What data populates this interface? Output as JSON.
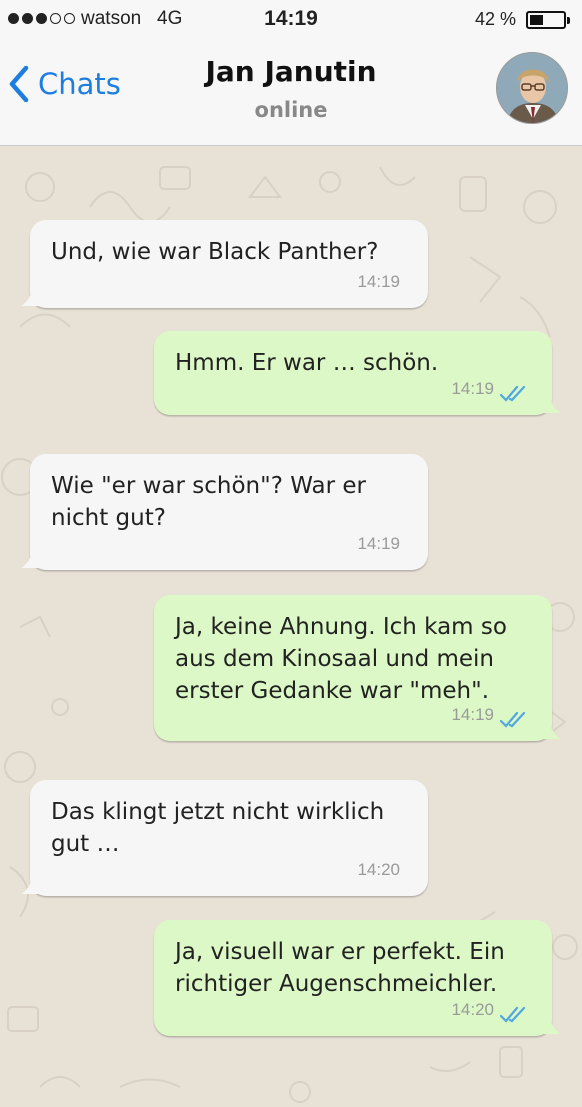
{
  "status_bar": {
    "carrier": "watson",
    "network": "4G",
    "time": "14:19",
    "battery_percent_label": "42 %",
    "battery_level": 0.42,
    "signal_bars_filled": 3,
    "signal_bars_total": 5
  },
  "header": {
    "back_label": "Chats",
    "contact_name": "Jan Janutin",
    "contact_status": "online"
  },
  "colors": {
    "accent": "#1e7ee0",
    "incoming_bubble": "#f6f6f6",
    "outgoing_bubble": "#dcf8c6",
    "read_ticks": "#4fa8e0",
    "chat_background": "#e8e1d6"
  },
  "messages": [
    {
      "direction": "incoming",
      "text": "Und, wie war Black Panther?",
      "time": "14:19"
    },
    {
      "direction": "outgoing",
      "text": "Hmm. Er war … schön.",
      "time": "14:19",
      "status": "read"
    },
    {
      "direction": "incoming",
      "text": "Wie \"er war schön\"? War er nicht gut?",
      "time": "14:19"
    },
    {
      "direction": "outgoing",
      "text": "Ja, keine Ahnung. Ich kam so aus dem Kinosaal und mein erster Gedanke war \"meh\".",
      "time": "14:19",
      "status": "read"
    },
    {
      "direction": "incoming",
      "text": "Das klingt jetzt nicht wirklich gut …",
      "time": "14:20"
    },
    {
      "direction": "outgoing",
      "text": "Ja, visuell war er perfekt. Ein richtiger Augenschmeichler.",
      "time": "14:20",
      "status": "read"
    }
  ],
  "icons": {
    "back": "chevron-left-icon",
    "read_receipt": "double-check-icon"
  }
}
